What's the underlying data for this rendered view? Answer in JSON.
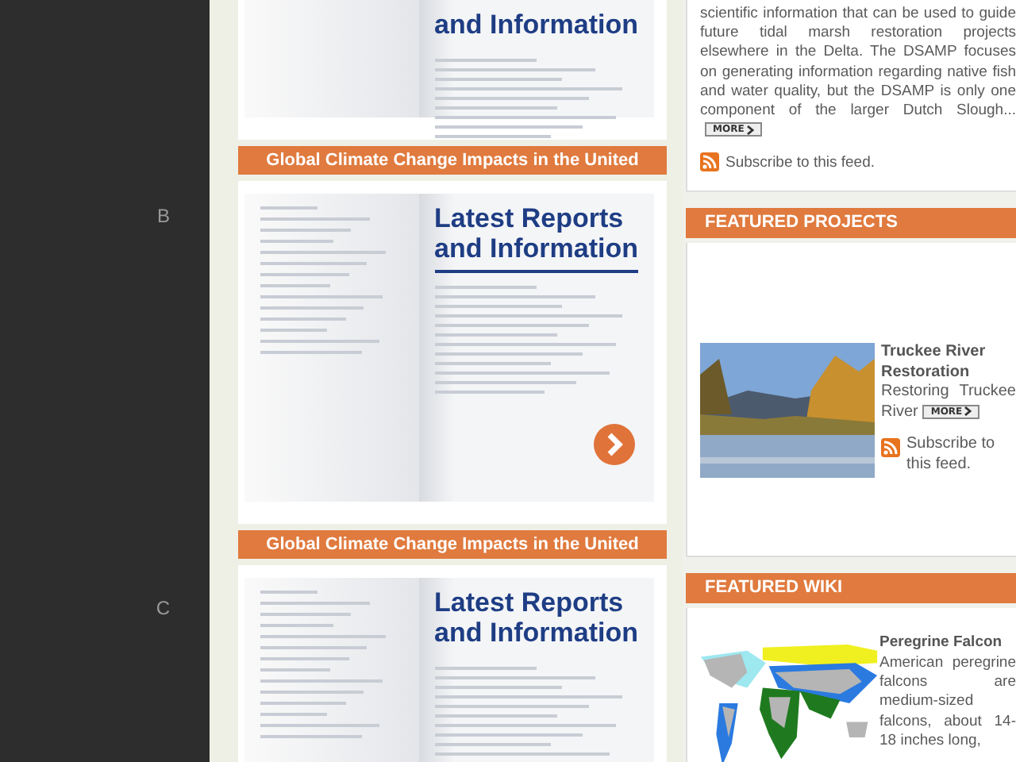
{
  "sidebar": {
    "markers": [
      "B",
      "C"
    ]
  },
  "reports": [
    {
      "headline": [
        "and Information"
      ],
      "caption": "Global Climate Change Impacts in the United",
      "arrow": false
    },
    {
      "headline": [
        "Latest Reports",
        "and Information"
      ],
      "caption": "Global Climate Change Impacts in the United",
      "arrow": true
    },
    {
      "headline": [
        "Latest Reports",
        "and Information"
      ],
      "arrow": false
    }
  ],
  "feed": {
    "body": "scientific information that can be used to guide future tidal marsh restoration projects elsewhere in the Delta. The DSAMP focuses on generating information regarding native fish and water quality, but the DSAMP is only one component of the larger Dutch Slough...",
    "more": "MORE",
    "subscribe": "Subscribe to this feed."
  },
  "featured_projects": {
    "title": "FEATURED PROJECTS",
    "items": [
      {
        "title": "Truckee River Restoration",
        "summary": "Restoring Truckee River",
        "more": "MORE",
        "subscribe": "Subscribe to this feed."
      }
    ]
  },
  "featured_wiki": {
    "title": "FEATURED WIKI",
    "item": {
      "title": "Peregrine Falcon",
      "summary": "American peregrine falcons are medium-sized falcons, about 14-18 inches long,"
    }
  }
}
